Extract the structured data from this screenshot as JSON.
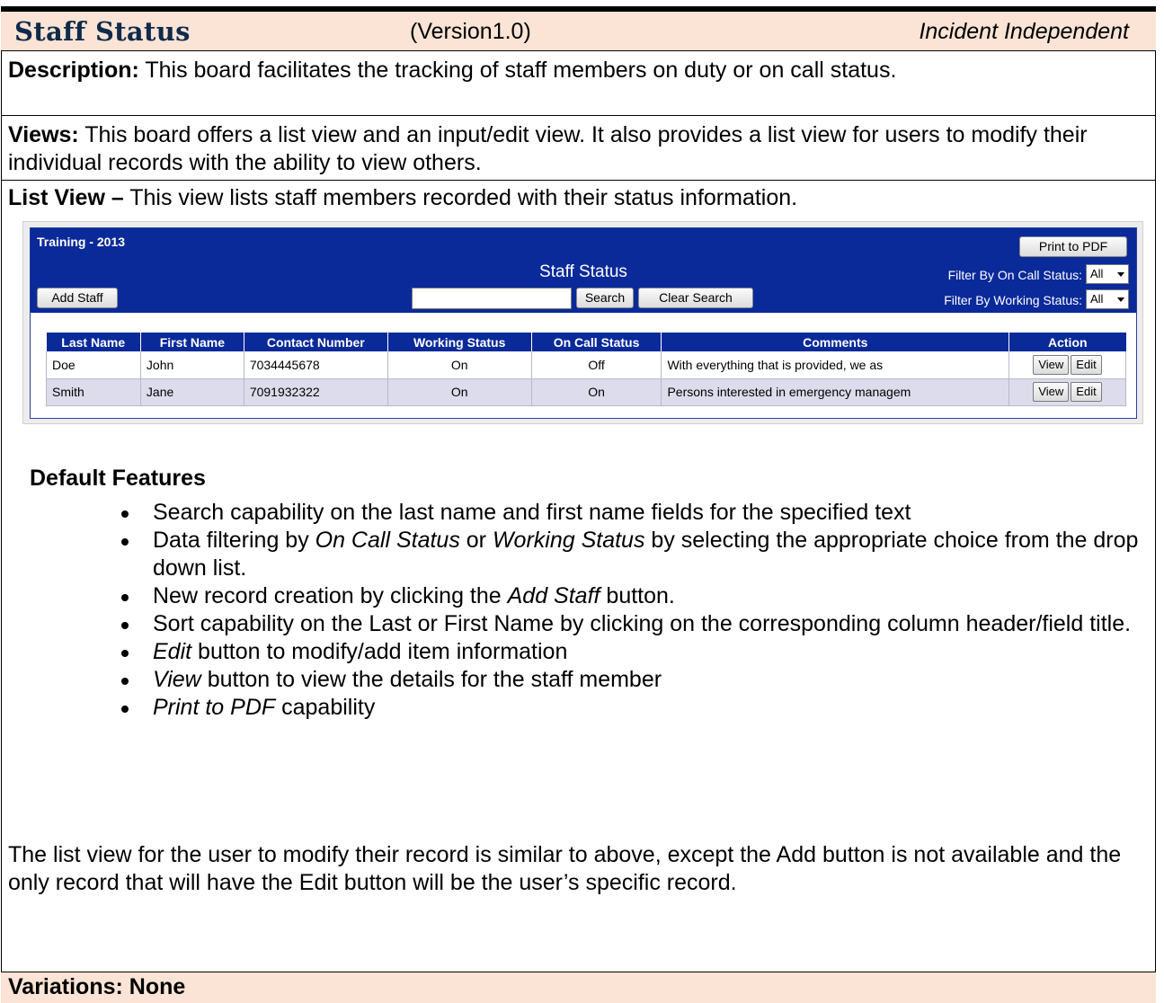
{
  "header": {
    "title": "Staff Status",
    "version": "(Version1.0)",
    "incident": "Incident Independent"
  },
  "description": {
    "label": "Description:",
    "text": " This board facilitates the tracking of staff members on duty or on call status."
  },
  "views": {
    "label": "Views:",
    "text": " This board offers a list view and an input/edit view.  It also provides a list view for users to modify their individual records with the ability to view others."
  },
  "list_view": {
    "label": "List View –",
    "text": " This view lists staff members recorded with their status information."
  },
  "app": {
    "board_name": "Training - 2013",
    "title": "Staff Status",
    "print_button": "Print to PDF",
    "add_button": "Add Staff",
    "search_value": "",
    "search_button": "Search",
    "clear_button": "Clear Search",
    "filter_on_call_label": "Filter By On Call Status:",
    "filter_on_call_value": "All",
    "filter_working_label": "Filter By Working Status:",
    "filter_working_value": "All",
    "columns": [
      "Last Name",
      "First Name",
      "Contact Number",
      "Working Status",
      "On Call Status",
      "Comments",
      "Action"
    ],
    "rows": [
      {
        "last": "Doe",
        "first": "John",
        "contact": "7034445678",
        "working": "On",
        "oncall": "Off",
        "comments": "With everything that is provided, we as",
        "view": "View",
        "edit": "Edit"
      },
      {
        "last": "Smith",
        "first": "Jane",
        "contact": "7091932322",
        "working": "On",
        "oncall": "On",
        "comments": "Persons interested in emergency managem",
        "view": "View",
        "edit": "Edit"
      }
    ]
  },
  "features": {
    "heading": "Default Features",
    "items": [
      {
        "pre": "Search capability on the last name and first name fields for the specified text",
        "em": "",
        "mid": "",
        "em2": "",
        "post": ""
      },
      {
        "pre": "Data filtering by ",
        "em": "On Call Status",
        "mid": " or ",
        "em2": "Working Status",
        "post": " by selecting the appropriate choice from the drop down list."
      },
      {
        "pre": "New record creation by clicking the ",
        "em": "Add Staff",
        "mid": " button.",
        "em2": "",
        "post": ""
      },
      {
        "pre": "Sort capability on the Last or First Name by clicking on the corresponding column header/field title.",
        "em": "",
        "mid": "",
        "em2": "",
        "post": ""
      },
      {
        "pre": "",
        "em": "Edit",
        "mid": " button to modify/add item information",
        "em2": "",
        "post": ""
      },
      {
        "pre": "",
        "em": "View",
        "mid": " button to view the details for the staff member",
        "em2": "",
        "post": ""
      },
      {
        "pre": "",
        "em": "Print to PDF",
        "mid": " capability",
        "em2": "",
        "post": ""
      }
    ]
  },
  "closing": "The list view for the user to modify their record is similar to above, except the Add button is not available and the only record that will have the Edit button will be the user’s specific record.",
  "variations": "Variations: None"
}
